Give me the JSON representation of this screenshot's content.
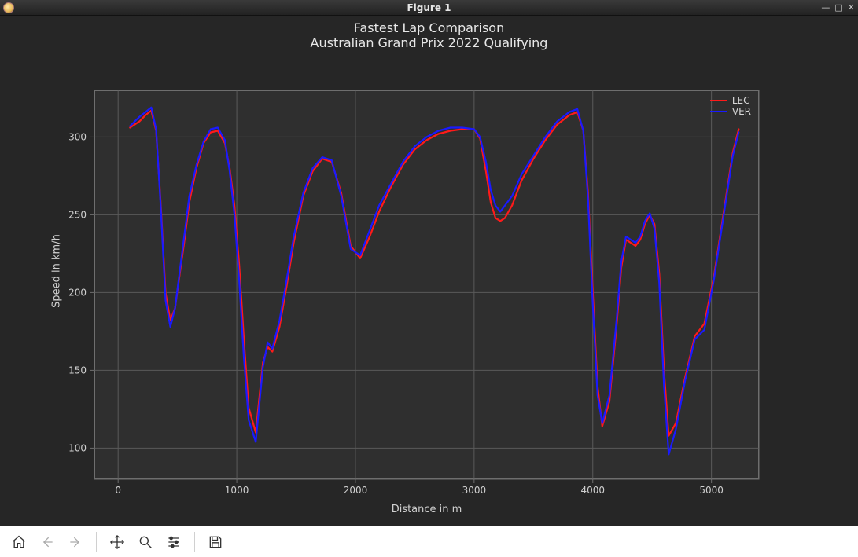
{
  "window": {
    "title": "Figure 1"
  },
  "chart_data": {
    "type": "line",
    "title": "Fastest Lap Comparison",
    "subtitle": "Australian Grand Prix 2022 Qualifying",
    "xlabel": "Distance in m",
    "ylabel": "Speed in km/h",
    "xlim": [
      -200,
      5400
    ],
    "ylim": [
      80,
      330
    ],
    "xticks": [
      0,
      1000,
      2000,
      3000,
      4000,
      5000
    ],
    "yticks": [
      100,
      150,
      200,
      250,
      300
    ],
    "legend": [
      "LEC",
      "VER"
    ],
    "colors": {
      "LEC": "#ff1a1a",
      "VER": "#1a1aff"
    },
    "series": [
      {
        "name": "LEC",
        "x": [
          100,
          180,
          230,
          280,
          320,
          360,
          400,
          440,
          480,
          520,
          560,
          600,
          660,
          720,
          780,
          840,
          900,
          940,
          980,
          1020,
          1060,
          1100,
          1160,
          1220,
          1260,
          1300,
          1360,
          1420,
          1480,
          1560,
          1640,
          1720,
          1800,
          1880,
          1960,
          2040,
          2120,
          2200,
          2300,
          2400,
          2500,
          2600,
          2700,
          2800,
          2900,
          3000,
          3050,
          3100,
          3140,
          3180,
          3220,
          3260,
          3320,
          3400,
          3500,
          3600,
          3700,
          3800,
          3870,
          3920,
          3960,
          4000,
          4040,
          4080,
          4140,
          4200,
          4240,
          4280,
          4320,
          4360,
          4400,
          4440,
          4480,
          4520,
          4560,
          4600,
          4640,
          4700,
          4780,
          4860,
          4940,
          5020,
          5100,
          5180,
          5230
        ],
        "y": [
          306,
          310,
          314,
          317,
          304,
          256,
          200,
          182,
          190,
          212,
          234,
          258,
          280,
          296,
          303,
          304,
          296,
          280,
          256,
          218,
          170,
          126,
          110,
          155,
          165,
          162,
          178,
          204,
          232,
          262,
          278,
          286,
          284,
          264,
          230,
          222,
          236,
          252,
          268,
          282,
          292,
          298,
          302,
          304,
          305,
          305,
          299,
          278,
          258,
          248,
          246,
          248,
          256,
          272,
          286,
          298,
          308,
          314,
          316,
          304,
          264,
          200,
          140,
          114,
          130,
          178,
          216,
          234,
          232,
          230,
          234,
          244,
          250,
          244,
          212,
          150,
          108,
          116,
          146,
          172,
          180,
          210,
          250,
          290,
          305
        ]
      },
      {
        "name": "VER",
        "x": [
          100,
          180,
          230,
          280,
          320,
          360,
          400,
          440,
          480,
          520,
          560,
          600,
          660,
          720,
          780,
          840,
          900,
          940,
          980,
          1020,
          1060,
          1100,
          1160,
          1220,
          1260,
          1300,
          1360,
          1420,
          1480,
          1560,
          1640,
          1720,
          1800,
          1880,
          1960,
          2040,
          2120,
          2200,
          2300,
          2400,
          2500,
          2600,
          2700,
          2800,
          2900,
          3000,
          3050,
          3100,
          3140,
          3180,
          3220,
          3260,
          3320,
          3400,
          3500,
          3600,
          3700,
          3800,
          3870,
          3920,
          3960,
          4000,
          4040,
          4080,
          4140,
          4200,
          4240,
          4280,
          4320,
          4360,
          4400,
          4440,
          4480,
          4520,
          4560,
          4600,
          4640,
          4700,
          4780,
          4860,
          4940,
          5020,
          5100,
          5180,
          5230
        ],
        "y": [
          307,
          313,
          316,
          319,
          305,
          254,
          195,
          178,
          190,
          214,
          238,
          262,
          282,
          297,
          305,
          306,
          298,
          278,
          250,
          208,
          158,
          118,
          104,
          152,
          168,
          164,
          182,
          208,
          236,
          264,
          280,
          287,
          285,
          262,
          228,
          224,
          240,
          256,
          270,
          284,
          294,
          300,
          304,
          306,
          306,
          305,
          300,
          284,
          266,
          256,
          252,
          256,
          262,
          276,
          288,
          300,
          310,
          316,
          318,
          304,
          260,
          192,
          134,
          116,
          134,
          182,
          220,
          236,
          234,
          232,
          236,
          246,
          251,
          241,
          206,
          140,
          96,
          112,
          144,
          170,
          176,
          208,
          248,
          288,
          303
        ]
      }
    ]
  },
  "toolbar": {
    "home": "Home",
    "back": "Back",
    "forward": "Forward",
    "pan": "Pan",
    "zoom": "Zoom",
    "configure": "Configure subplots",
    "save": "Save"
  }
}
